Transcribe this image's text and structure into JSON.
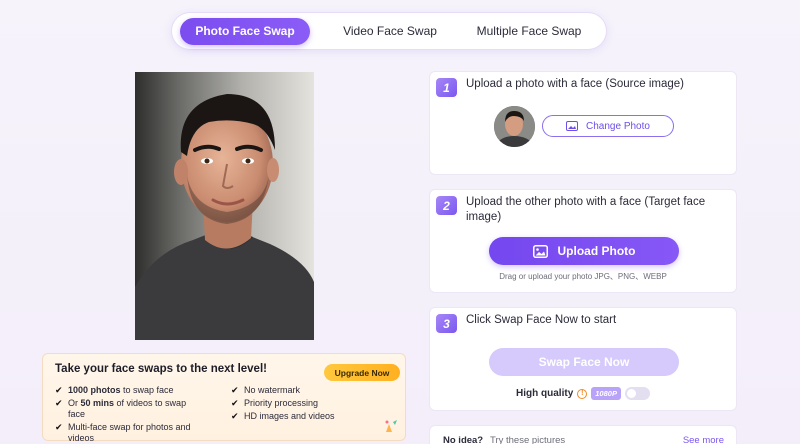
{
  "tabs": [
    {
      "label": "Photo Face Swap",
      "active": true
    },
    {
      "label": "Video Face Swap",
      "active": false
    },
    {
      "label": "Multiple Face Swap",
      "active": false
    }
  ],
  "upgrade": {
    "title": "Take your face swaps to the next level!",
    "button": "Upgrade Now",
    "features_left": [
      {
        "bold": "1000 photos",
        "pre": "",
        "post": " to swap face"
      },
      {
        "bold": "50 mins",
        "pre": "Or ",
        "post": " of videos to swap face"
      },
      {
        "bold": "",
        "pre": "Multi-face swap for photos and videos",
        "post": ""
      }
    ],
    "features_right": [
      "No watermark",
      "Priority processing",
      "HD images and videos"
    ]
  },
  "steps": {
    "step1": {
      "number": "1",
      "text": "Upload a photo with a face (Source image)",
      "change_button": "Change Photo"
    },
    "step2": {
      "number": "2",
      "text": "Upload the other photo with a face (Target face image)",
      "upload_button": "Upload Photo",
      "hint": "Drag or upload your photo JPG、PNG、WEBP"
    },
    "step3": {
      "number": "3",
      "text": "Click Swap Face Now to start",
      "swap_button": "Swap Face Now",
      "quality_label": "High quality",
      "quality_badge": "1080P",
      "quality_enabled": false
    }
  },
  "ideas": {
    "label": "No idea?",
    "try_text": "Try these pictures",
    "see_more": "See more"
  },
  "colors": {
    "accent": "#7b4df0",
    "upgrade_btn": "#ffb020"
  }
}
